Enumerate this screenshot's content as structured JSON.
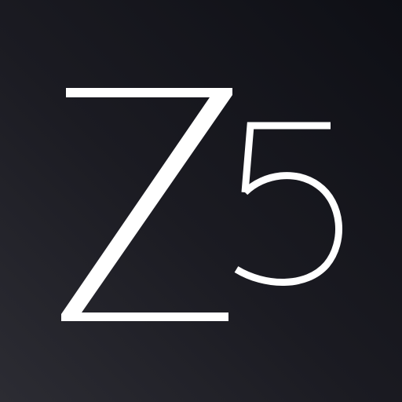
{
  "logo": {
    "text": "Z5",
    "letter": "Z",
    "digit": "5",
    "glyph_color": "#ffffff",
    "background_colors": [
      "#2c2c33",
      "#1b1b22",
      "#0e0f15"
    ]
  }
}
